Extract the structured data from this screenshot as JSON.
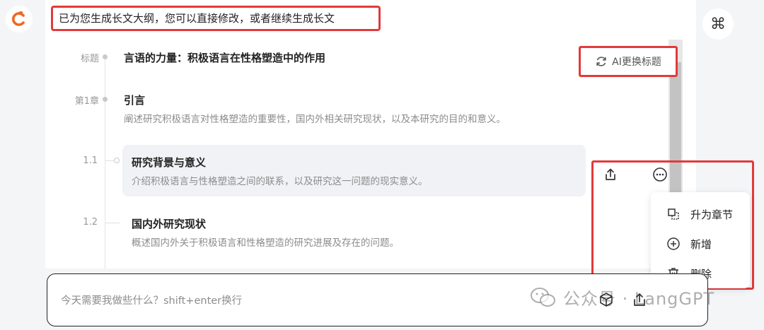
{
  "banner": {
    "text": "已为您生成长文大纲，您可以直接修改，或者继续生成长文"
  },
  "outline": {
    "title_label": "标题",
    "title": "言语的力量：积极语言在性格塑造中的作用",
    "chapter": {
      "label": "第1章",
      "title": "引言",
      "desc": "阐述研究积极语言对性格塑造的重要性，国内外相关研究现状，以及本研究的目的和意义。"
    },
    "sections": [
      {
        "label": "1.1",
        "title": "研究背景与意义",
        "desc": "介绍积极语言与性格塑造之间的联系，以及研究这一问题的现实意义。"
      },
      {
        "label": "1.2",
        "title": "国内外研究现状",
        "desc": "概述国内外关于积极语言和性格塑造的研究进展及存在的问题。"
      }
    ]
  },
  "ai_title_button": {
    "label": "AI更换标题"
  },
  "context_menu": {
    "items": [
      {
        "label": "升为章节",
        "icon": "promote-icon"
      },
      {
        "label": "新增",
        "icon": "plus-circle-icon"
      },
      {
        "label": "删除",
        "icon": "trash-icon"
      }
    ]
  },
  "input": {
    "placeholder": "今天需要我做些什么？shift+enter换行"
  },
  "watermark": {
    "text": "公众号 · LangGPT"
  },
  "colors": {
    "brand": "#f26522",
    "highlight_border": "#e23a3a"
  }
}
